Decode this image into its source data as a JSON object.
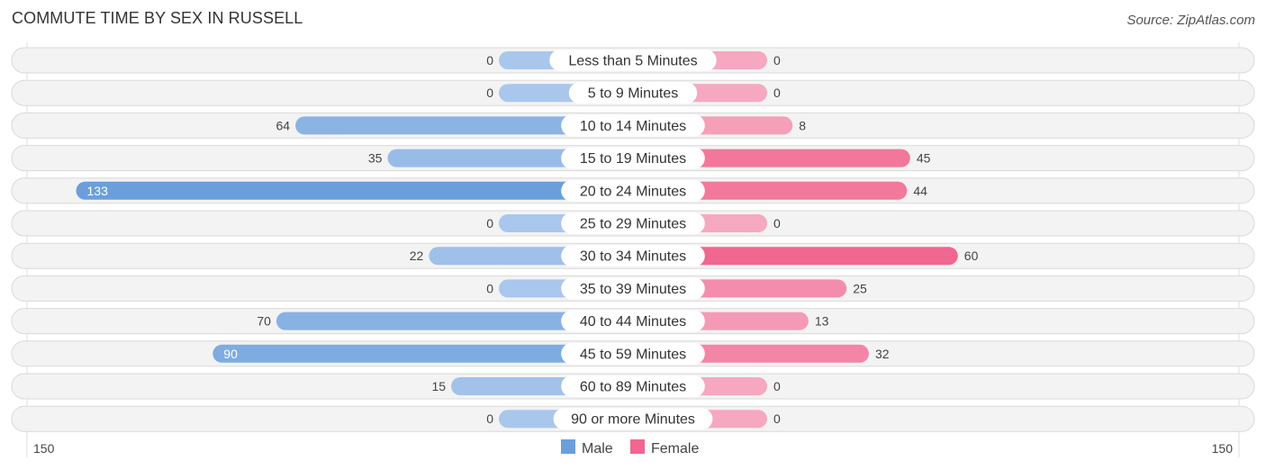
{
  "header": {
    "title": "COMMUTE TIME BY SEX IN RUSSELL",
    "source": "Source: ZipAtlas.com"
  },
  "colors": {
    "male": "#6a9fdc",
    "male_light": "#a9c7ec",
    "female": "#f0678f",
    "female_light": "#f6a8c0",
    "row_bg": "#f3f3f3"
  },
  "chart_data": {
    "type": "bar",
    "orientation": "horizontal-diverging",
    "title": "COMMUTE TIME BY SEX IN RUSSELL",
    "categories": [
      "Less than 5 Minutes",
      "5 to 9 Minutes",
      "10 to 14 Minutes",
      "15 to 19 Minutes",
      "20 to 24 Minutes",
      "25 to 29 Minutes",
      "30 to 34 Minutes",
      "35 to 39 Minutes",
      "40 to 44 Minutes",
      "45 to 59 Minutes",
      "60 to 89 Minutes",
      "90 or more Minutes"
    ],
    "series": [
      {
        "name": "Male",
        "values": [
          0,
          0,
          64,
          35,
          133,
          0,
          22,
          0,
          70,
          90,
          15,
          0
        ]
      },
      {
        "name": "Female",
        "values": [
          0,
          0,
          8,
          45,
          44,
          0,
          60,
          25,
          13,
          32,
          0,
          0
        ]
      }
    ],
    "axis": {
      "left_label": "150",
      "right_label": "150",
      "max": 150
    },
    "legend": {
      "position": "bottom-center",
      "items": [
        "Male",
        "Female"
      ]
    }
  }
}
